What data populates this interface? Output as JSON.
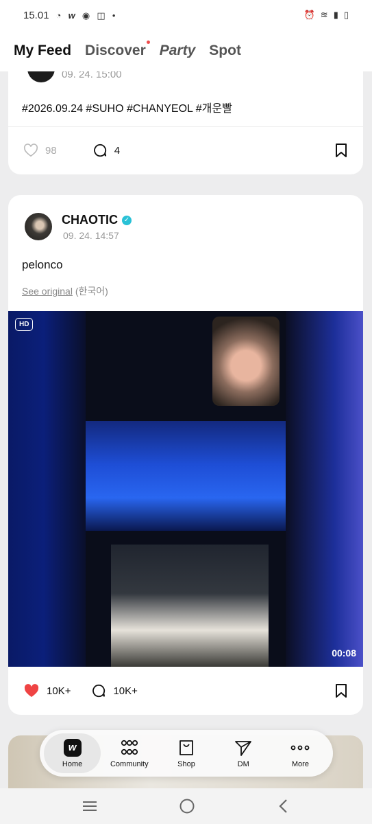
{
  "status_bar": {
    "time": "15.01",
    "left_icons": [
      "whatsapp-icon",
      "weverse-icon",
      "chrome-icon",
      "instagram-icon",
      "dot-icon"
    ],
    "right_icons": [
      "alarm-icon",
      "wifi-icon",
      "signal-icon",
      "battery-icon"
    ]
  },
  "top_tabs": [
    {
      "label": "My Feed",
      "active": true
    },
    {
      "label": "Discover",
      "has_dot": true
    },
    {
      "label": "Party"
    },
    {
      "label": "Spot"
    }
  ],
  "post1": {
    "date": "09. 24. 15:00",
    "text": "#2026.09.24 #SUHO #CHANYEOL #개운빨",
    "likes": "98",
    "comments": "4"
  },
  "post2": {
    "author": "CHAOTIC",
    "date": "09. 24. 14:57",
    "text": "pelonco",
    "see_original": "See original",
    "language": "(한국어)",
    "quality_badge": "HD",
    "duration": "00:08",
    "likes": "10K+",
    "comments": "10K+"
  },
  "bottom_nav": [
    {
      "label": "Home",
      "active": true
    },
    {
      "label": "Community"
    },
    {
      "label": "Shop"
    },
    {
      "label": "DM"
    },
    {
      "label": "More"
    }
  ],
  "colors": {
    "like_red": "#ef4444",
    "verified": "#29c1d6",
    "tab_dot": "#ef4d4d"
  }
}
